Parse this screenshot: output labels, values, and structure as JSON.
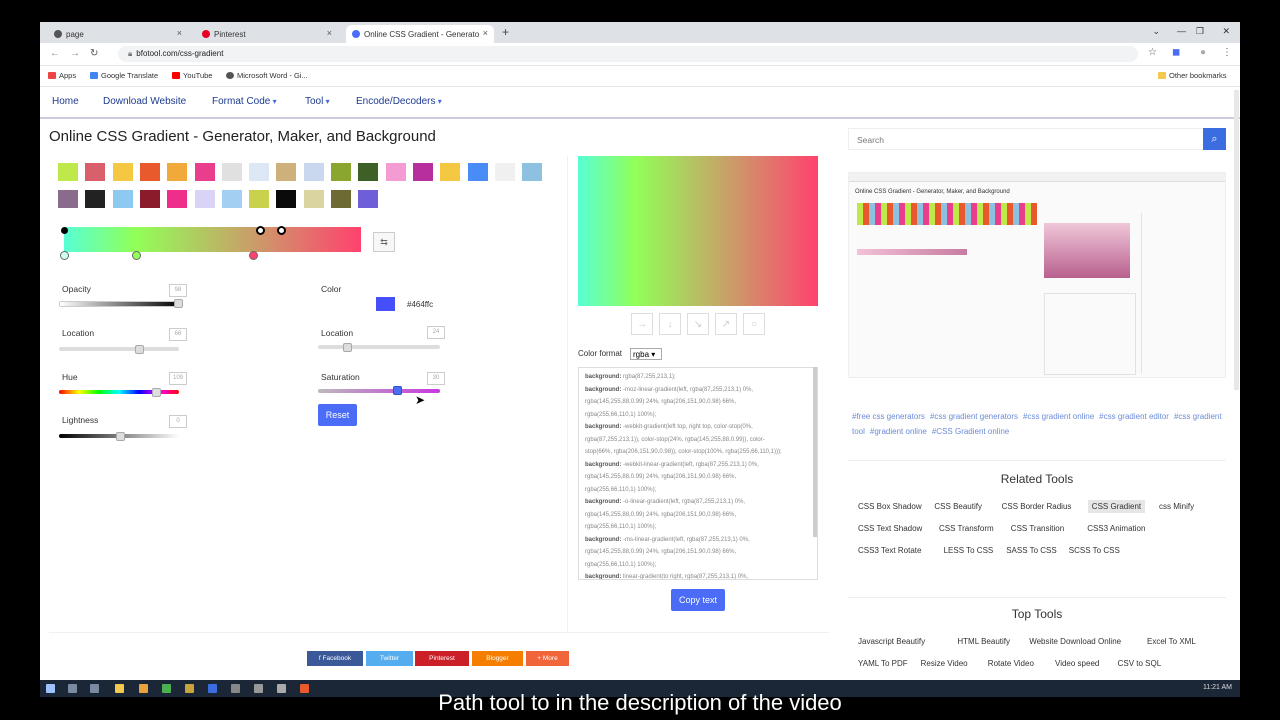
{
  "browser": {
    "tabs": [
      {
        "title": "page",
        "favicon_color": "#555555"
      },
      {
        "title": "Pinterest",
        "favicon_color": "#e60023"
      },
      {
        "title": "Online CSS Gradient - Generato",
        "favicon_color": "#4a6cf7"
      }
    ],
    "new_tab": "+",
    "close": "×",
    "url": "bfotool.com/css-gradient",
    "bookmarks": [
      {
        "label": "Apps",
        "color": "#e44"
      },
      {
        "label": "Google Translate",
        "color": "#4285f4"
      },
      {
        "label": "YouTube",
        "color": "#ff0000"
      },
      {
        "label": "Microsoft Word - Gi...",
        "color": "#555555"
      }
    ],
    "other_bookmarks": "Other bookmarks"
  },
  "nav": {
    "items": [
      "Home",
      "Download Website",
      "Format Code",
      "Tool",
      "Encode/Decoders"
    ]
  },
  "page": {
    "title": "Online CSS Gradient - Generator, Maker, and Background"
  },
  "swatches": [
    "#bfe84a",
    "#d9606b",
    "#f5c842",
    "#e85a2b",
    "#f2a93b",
    "#e83e8c",
    "#e0e0e0",
    "#dce8f5",
    "#cdb07a",
    "#c9d8ef",
    "#8aa62e",
    "#3e5f26",
    "#f59bd3",
    "#b72e9e",
    "#f5c842",
    "#4a8cf7",
    "#f0f0f0",
    "#8ec1df",
    "#8a6b8c",
    "#222222",
    "#8ec9f2",
    "#8b1a2b",
    "#ef2d8a",
    "#d9d4f5",
    "#a3d0f2",
    "#c9d24a",
    "#0a0a0a",
    "#d9d4a0",
    "#6e6a34",
    "#6e5fd8"
  ],
  "controls": {
    "opacity": {
      "label": "Opacity",
      "value": "98"
    },
    "location_left": {
      "label": "Location",
      "value": "66"
    },
    "hue": {
      "label": "Hue",
      "value": "109"
    },
    "lightness": {
      "label": "Lightness",
      "value": "0"
    },
    "color": {
      "label": "Color",
      "hex": "#464ffc",
      "swatch": "#464ffc"
    },
    "location_right": {
      "label": "Location",
      "value": "24"
    },
    "saturation": {
      "label": "Saturation",
      "value": "30"
    },
    "reset": "Reset"
  },
  "output": {
    "direction_icons": [
      "→",
      "↓",
      "↘",
      "↗",
      "○"
    ],
    "color_format_label": "Color format",
    "color_format_value": "rgba ▾",
    "code_lines": [
      [
        "background:",
        "rgba(87,255,213,1);"
      ],
      [
        "background:",
        "-moz-linear-gradient(left, rgba(87,255,213,1) 0%,"
      ],
      [
        "",
        "rgba(145,255,88,0.99) 24%, rgba(206,151,90,0.98) 66%,"
      ],
      [
        "",
        "rgba(255,66,110,1) 100%);"
      ],
      [
        "background:",
        "-webkit-gradient(left top, right top, color-stop(0%,"
      ],
      [
        "",
        "rgba(87,255,213,1)), color-stop(24%, rgba(145,255,88,0.99)), color-"
      ],
      [
        "",
        "stop(66%, rgba(206,151,90,0.98)), color-stop(100%, rgba(255,66,110,1)));"
      ],
      [
        "background:",
        "-webkit-linear-gradient(left, rgba(87,255,213,1) 0%,"
      ],
      [
        "",
        "rgba(145,255,88,0.99) 24%, rgba(206,151,90,0.98) 66%,"
      ],
      [
        "",
        "rgba(255,66,110,1) 100%);"
      ],
      [
        "background:",
        "-o-linear-gradient(left, rgba(87,255,213,1) 0%,"
      ],
      [
        "",
        "rgba(145,255,88,0.99) 24%, rgba(206,151,90,0.98) 66%,"
      ],
      [
        "",
        "rgba(255,66,110,1) 100%);"
      ],
      [
        "background:",
        "-ms-linear-gradient(left, rgba(87,255,213,1) 0%,"
      ],
      [
        "",
        "rgba(145,255,88,0.99) 24%, rgba(206,151,90,0.98) 66%,"
      ],
      [
        "",
        "rgba(255,66,110,1) 100%);"
      ],
      [
        "background:",
        "linear-gradient(to right, rgba(87,255,213,1) 0%,"
      ]
    ],
    "copy": "Copy text"
  },
  "share": [
    {
      "label": "f  Facebook",
      "color": "#3b5998"
    },
    {
      "label": "Twitter",
      "color": "#55acee"
    },
    {
      "label": "Pinterest",
      "color": "#cb2027"
    },
    {
      "label": "Blogger",
      "color": "#f57d00"
    },
    {
      "label": "+  More",
      "color": "#f0653a"
    }
  ],
  "sidebar": {
    "search_placeholder": "Search",
    "tags": [
      "#free css generators",
      "#css gradient generators",
      "#css gradient online",
      "#css gradient editor",
      "#css gradient tool",
      "#gradient online",
      "#CSS Gradient online"
    ],
    "related_title": "Related Tools",
    "related_tools": [
      [
        "CSS Box Shadow",
        "CSS Beautify",
        "CSS Border Radius",
        "CSS Gradient",
        "css Minify"
      ],
      [
        "CSS Text Shadow",
        "CSS Transform",
        "CSS Transition",
        "CSS3 Animation"
      ],
      [
        "CSS3 Text Rotate",
        "LESS To CSS",
        "SASS To CSS",
        "SCSS To CSS"
      ]
    ],
    "top_title": "Top Tools",
    "top_tools": [
      [
        "Javascript Beautify",
        "HTML Beautify",
        "Website Download Online",
        "Excel To XML"
      ],
      [
        "YAML To PDF",
        "Resize Video",
        "Rotate Video",
        "Video speed",
        "CSV to SQL"
      ]
    ]
  },
  "taskbar": {
    "time": "11:21 AM"
  },
  "caption": "Path tool to in the description of the video"
}
